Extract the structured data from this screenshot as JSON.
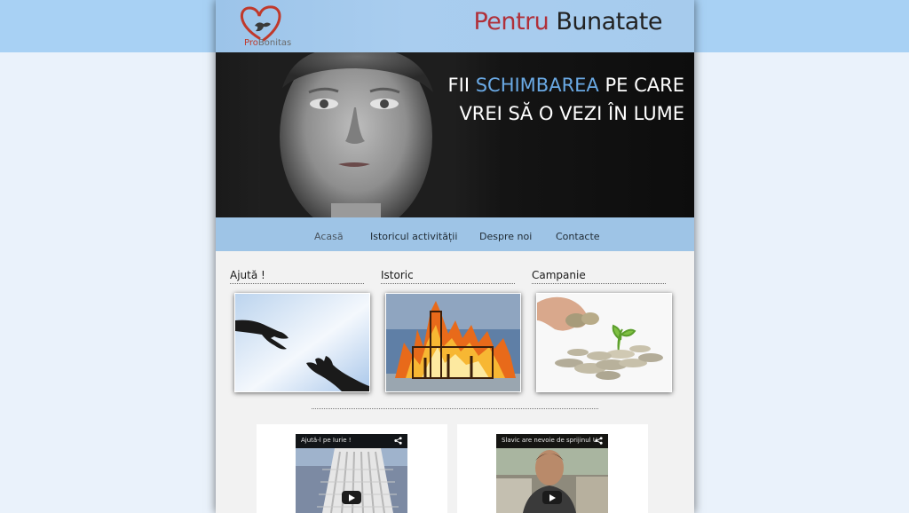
{
  "header": {
    "logo_text_pro": "Pro",
    "logo_text_rest": "Bonitas",
    "title_part1": "Pentru",
    "title_part2": "Bunatate"
  },
  "hero": {
    "line1_pre": "FII",
    "line1_highlight": "SCHIMBAREA",
    "line1_post": "PE CARE",
    "line2": "VREI SĂ O VEZI ÎN LUME"
  },
  "nav": {
    "items": [
      {
        "label": "Acasă",
        "active": true
      },
      {
        "label": "Istoricul activității",
        "active": false
      },
      {
        "label": "Despre noi",
        "active": false
      },
      {
        "label": "Contacte",
        "active": false
      }
    ]
  },
  "columns": [
    {
      "title": "Ajută !"
    },
    {
      "title": "Istoric"
    },
    {
      "title": "Campanie"
    }
  ],
  "videos": [
    {
      "title": "Ajută-l pe Iurie !"
    },
    {
      "title": "Slavic are nevoie de sprijinul U"
    }
  ],
  "colors": {
    "accent_blue": "#6aa9e4",
    "title_red": "#b0303a",
    "nav_bg": "#9ec4e6",
    "header_bg": "#a8d1f4"
  }
}
